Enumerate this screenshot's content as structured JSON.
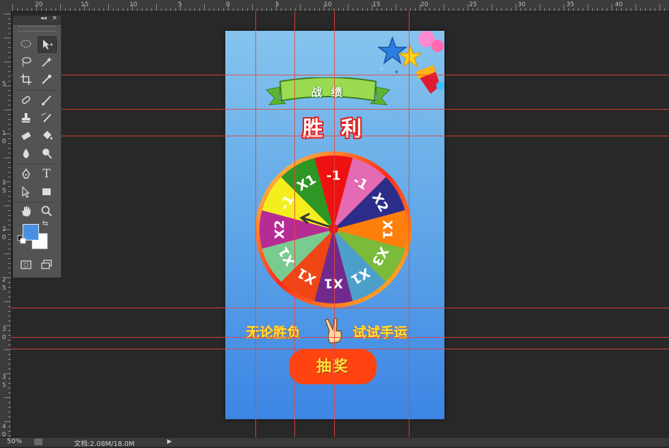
{
  "ruler": {
    "top_labels": [
      "20",
      "15",
      "10",
      "5",
      "0",
      "5",
      "10",
      "15",
      "20",
      "25",
      "30",
      "35",
      "40"
    ],
    "left_labels": [
      "5",
      "1",
      "0",
      "1",
      "5",
      "2",
      "0",
      "2",
      "5",
      "3",
      "0",
      "3",
      "5",
      "4",
      "0"
    ]
  },
  "tools": [
    "marquee-icon",
    "move-icon",
    "lasso-icon",
    "magic-wand-icon",
    "crop-icon",
    "eyedropper-icon",
    "healing-brush-icon",
    "brush-icon",
    "clone-stamp-icon",
    "history-brush-icon",
    "eraser-icon",
    "paint-bucket-icon",
    "blur-icon",
    "dodge-icon",
    "pen-icon",
    "type-icon",
    "path-selection-icon",
    "rectangle-icon",
    "hand-icon",
    "zoom-icon"
  ],
  "tool_glyphs": {
    "type": "T"
  },
  "colors": {
    "foreground": "#4a90e2",
    "background": "#ffffff",
    "guide": "#e9443d",
    "button": "#ff4411",
    "slogan": "#ffe23a"
  },
  "document": {
    "banner_title": "战 绩",
    "result_text": "胜 利",
    "slogan_left": "无论胜负",
    "slogan_right": "试试手运",
    "draw_button": "抽奖"
  },
  "wheel": {
    "segments": [
      {
        "label": "-1",
        "color": "#ee1111"
      },
      {
        "label": "-1",
        "color": "#e36ab3"
      },
      {
        "label": "X2",
        "color": "#2c2d8b"
      },
      {
        "label": "X1",
        "color": "#ff7f0c"
      },
      {
        "label": "X3",
        "color": "#7bbb3a"
      },
      {
        "label": "X1",
        "color": "#4d9fcb"
      },
      {
        "label": "X1",
        "color": "#702a8e"
      },
      {
        "label": "X1",
        "color": "#f04515"
      },
      {
        "label": "X1",
        "color": "#7acb8f"
      },
      {
        "label": "X2",
        "color": "#b62c95"
      },
      {
        "label": "-1",
        "color": "#f4ee1e"
      },
      {
        "label": "X1",
        "color": "#2e9624"
      }
    ]
  },
  "statusbar": {
    "zoom": "50%",
    "doc_info": "文档:2.08M/18.0M"
  }
}
